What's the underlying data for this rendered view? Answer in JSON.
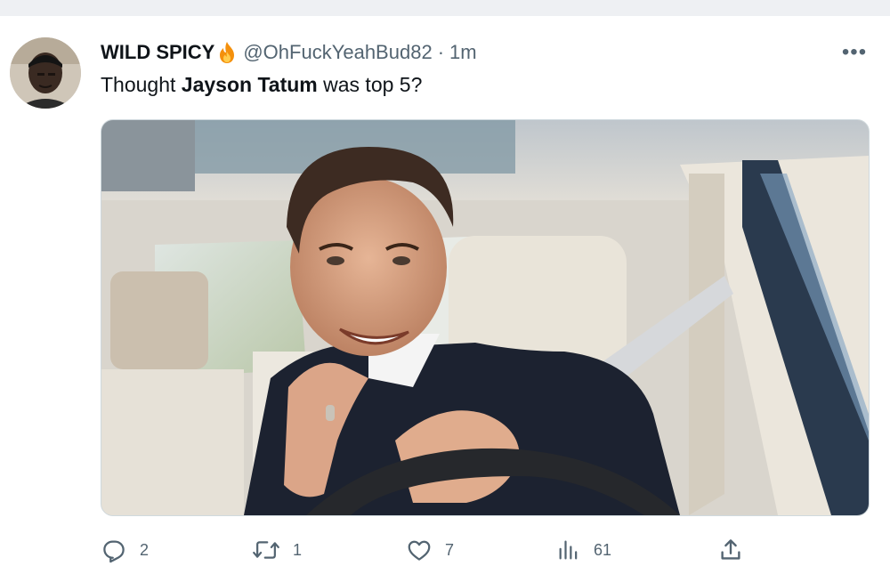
{
  "tweet": {
    "display_name": "WILD SPICY",
    "name_emoji": "fire-emoji",
    "handle": "@OhFuckYeahBud82",
    "separator": "·",
    "time": "1m",
    "text_before": "Thought ",
    "text_bold": "Jayson Tatum",
    "text_after": " was top 5?",
    "more_label": "•••"
  },
  "actions": {
    "replies": "2",
    "retweets": "1",
    "likes": "7",
    "views": "61"
  },
  "icons": {
    "avatar": "avatar-photo",
    "more": "more-icon",
    "reply": "reply-icon",
    "retweet": "retweet-icon",
    "like": "heart-icon",
    "views": "analytics-icon",
    "share": "share-icon"
  },
  "colors": {
    "text_primary": "#0f1419",
    "text_secondary": "#536471",
    "background": "#ffffff",
    "page_background": "#eef0f3"
  }
}
